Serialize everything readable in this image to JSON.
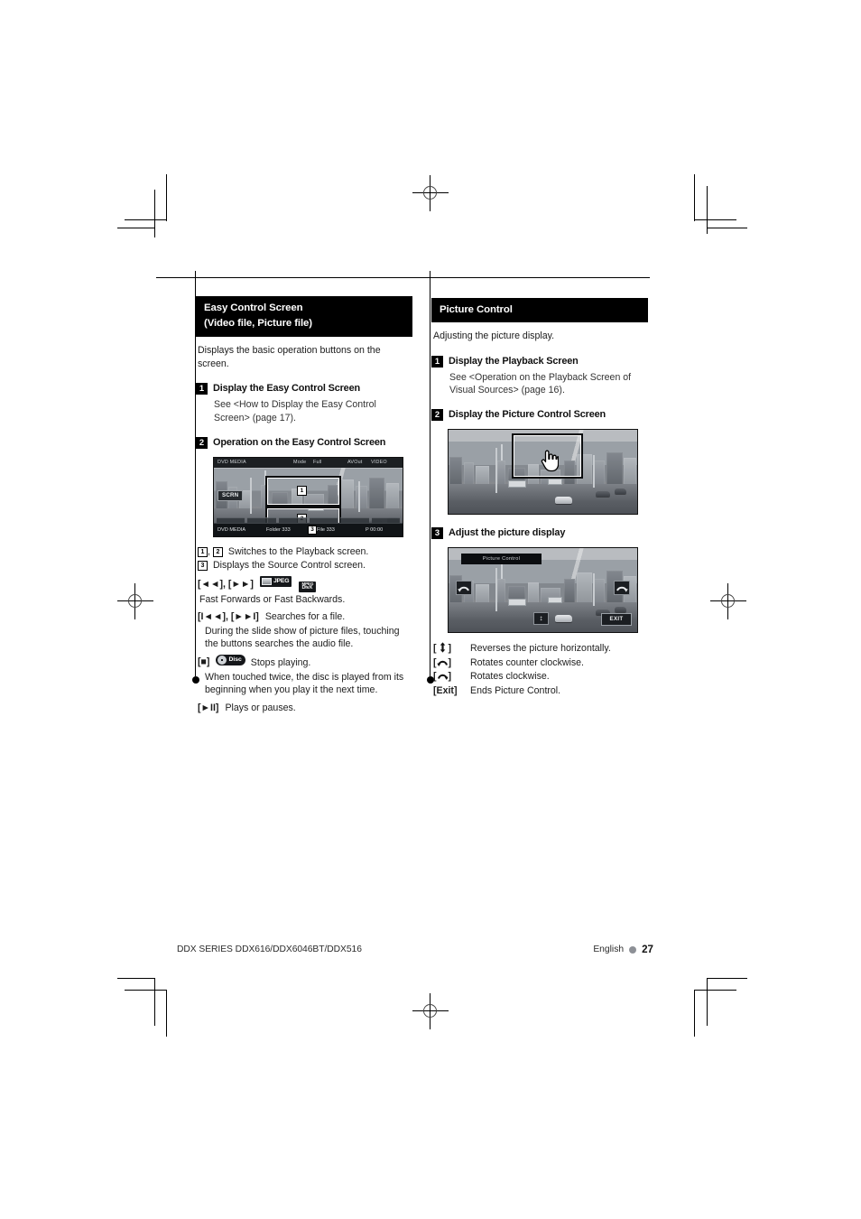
{
  "page": {
    "footer_model": "DDX SERIES  DDX616/DDX6046BT/DDX516",
    "footer_language": "English",
    "footer_page": "27"
  },
  "left_column": {
    "heading_line1": "Easy Control Screen",
    "heading_line2": "(Video file, Picture file)",
    "intro": "Displays the basic operation buttons on the screen.",
    "steps": [
      {
        "num": "1",
        "title": "Display the Easy Control Screen",
        "body": "See <How to Display the Easy Control Screen> (page 17)."
      },
      {
        "num": "2",
        "title": "Operation on the Easy Control Screen"
      }
    ],
    "screenshot": {
      "topbar_source": "DVD MEDIA",
      "topbar_mode_label": "Mode",
      "topbar_mode_value": "Full",
      "topbar_avout_label": "AVOut",
      "topbar_avout_value": "VIDEO",
      "scrn_button": "SCRN",
      "bottom_source": "DVD MEDIA",
      "bottom_folder": "Folder 333",
      "bottom_file": "File 333",
      "bottom_time": "P  00:00",
      "callout_1": "1",
      "callout_2": "2",
      "callout_3": "3"
    },
    "keys": [
      {
        "key": "1 , 2",
        "text": "Switches to the Playback screen.",
        "type": "badges12"
      },
      {
        "key": "3",
        "text": "Displays the Source Control screen.",
        "type": "badge3"
      },
      {
        "key": "[◄◄], [►►]",
        "text": "Fast Forwards or Fast Backwards.",
        "type": "media",
        "badges": [
          "JPEG",
          "MPEG/DivX"
        ]
      },
      {
        "key": "[I◄◄], [►►I]",
        "text": "Searches for a file.",
        "sub": "During the slide show of picture files, touching the buttons searches the audio file.",
        "type": "plain"
      },
      {
        "key": "[■]",
        "text": "Stops playing.",
        "sub": "When touched twice, the disc is played from its beginning when you play it the next time.",
        "type": "disc",
        "badge": "Disc"
      },
      {
        "key": "[►II]",
        "text": "Plays or pauses.",
        "type": "plain"
      }
    ]
  },
  "right_column": {
    "heading": "Picture Control",
    "intro": "Adjusting the picture display.",
    "steps": [
      {
        "num": "1",
        "title": "Display the Playback Screen",
        "body": "See <Operation on the Playback Screen of Visual Sources> (page 16)."
      },
      {
        "num": "2",
        "title": "Display the Picture Control Screen"
      },
      {
        "num": "3",
        "title": "Adjust the picture display"
      }
    ],
    "screenshot_picture_control": {
      "title_bar": "Picture Control",
      "flip_key": "↕",
      "exit_key": "EXIT"
    },
    "keys": [
      {
        "key": "[ ↕ ]",
        "text": "Reverses the picture horizontally.",
        "type": "flip"
      },
      {
        "key": "[ ↺ ]",
        "text": "Rotates counter clockwise.",
        "type": "ccw"
      },
      {
        "key": "[ ↻ ]",
        "text": "Rotates clockwise.",
        "type": "cw"
      },
      {
        "key": "[Exit]",
        "text": "Ends Picture Control.",
        "type": "plain"
      }
    ]
  }
}
